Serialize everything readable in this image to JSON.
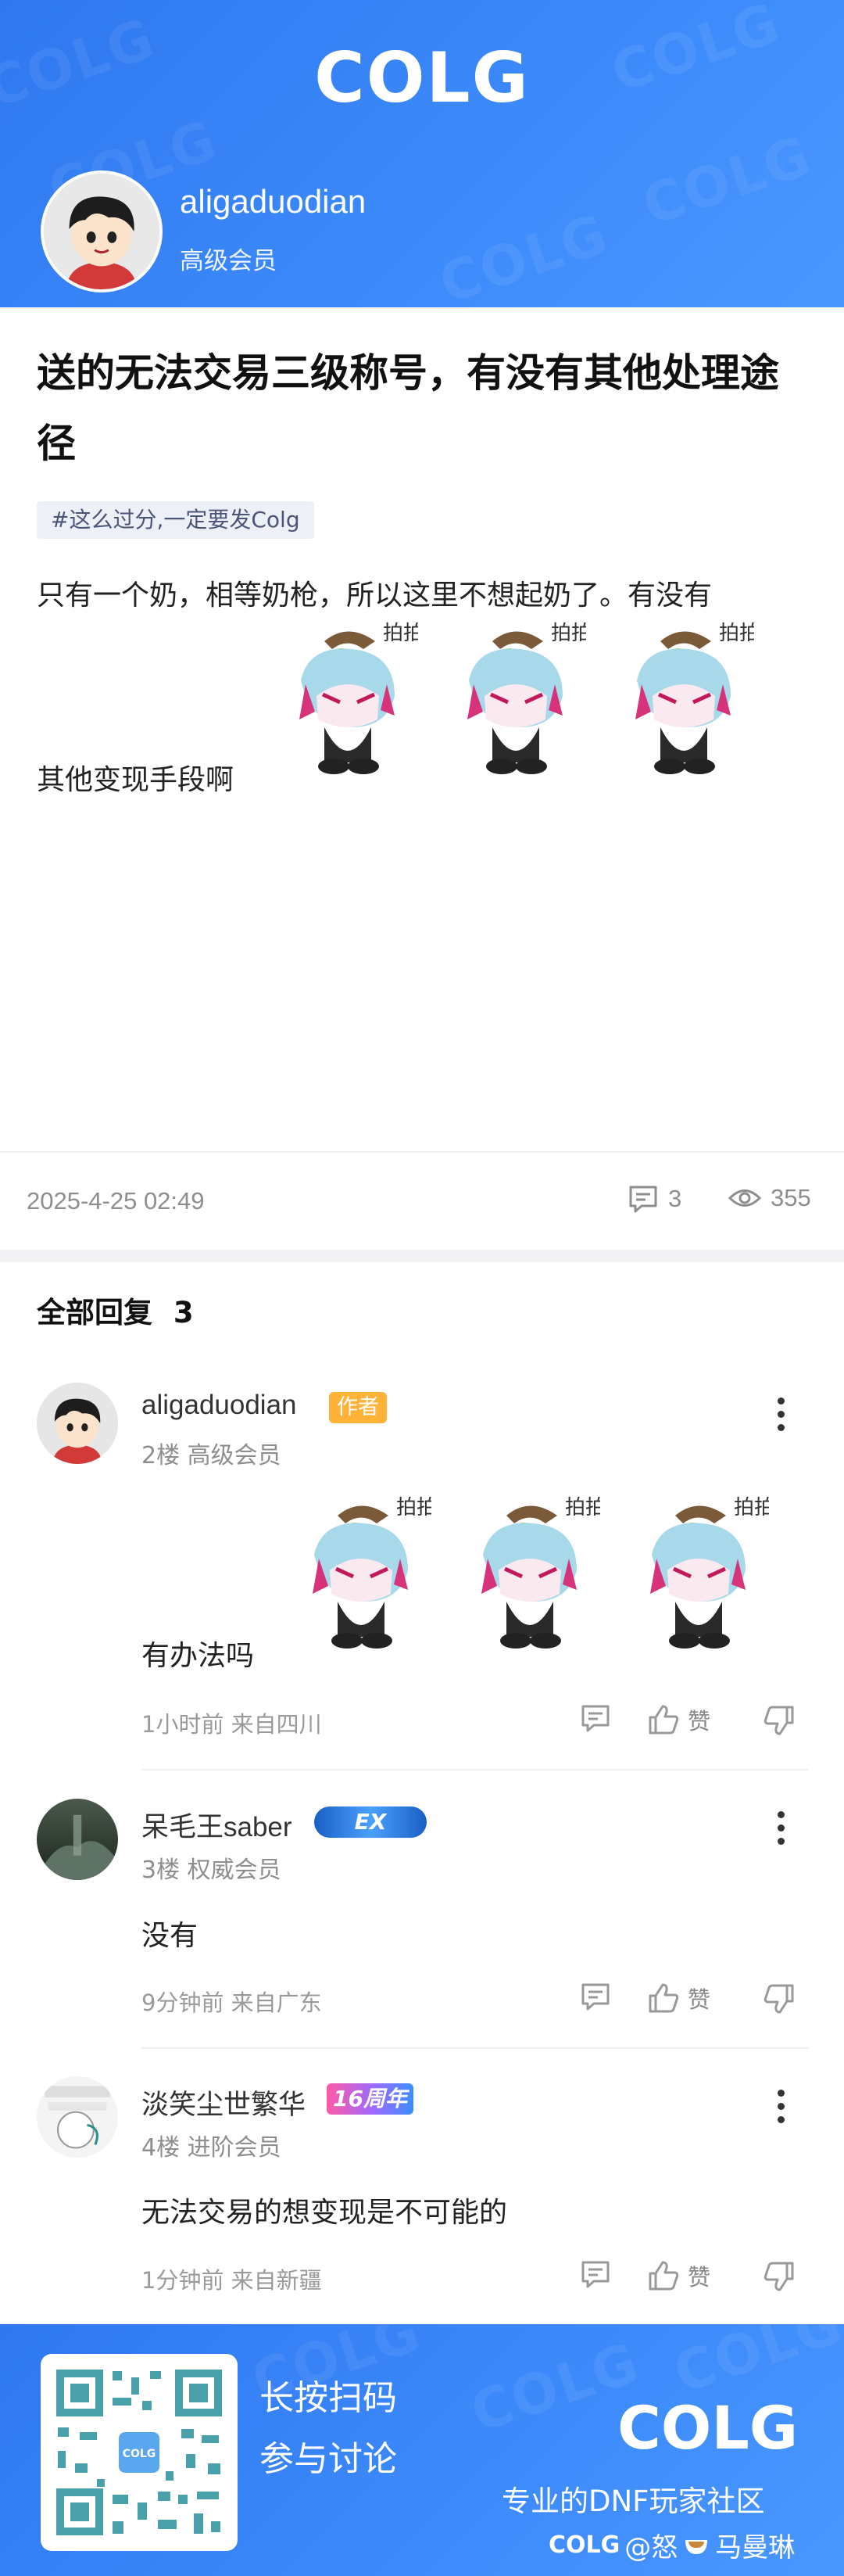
{
  "header": {
    "logo": "COLG",
    "user": {
      "name": "aligaduodian",
      "level": "高级会员"
    }
  },
  "post": {
    "title": "送的无法交易三级称号，有没有其他处理途径",
    "tag": "#这么过分,一定要发Colg",
    "body_line1": "只有一个奶，相等奶枪，所以这里不想起奶了。有没有",
    "body_line2": "其他变现手段啊",
    "sticker_text": "拍拍",
    "date": "2025-4-25 02:49",
    "comment_count": "3",
    "view_count": "355"
  },
  "replies": {
    "header": "全部回复",
    "count": "3",
    "like_label": "赞",
    "items": [
      {
        "name": "aligaduodian",
        "badge": "作者",
        "sub": "2楼 高级会员",
        "text": "有办法吗",
        "time": "1小时前 来自四川"
      },
      {
        "name": "呆毛王saber",
        "badge": "EX",
        "sub": "3楼 权威会员",
        "text": "没有",
        "time": "9分钟前 来自广东"
      },
      {
        "name": "淡笑尘世繁华",
        "badge": "16周年",
        "sub": "4楼 进阶会员",
        "text": "无法交易的想变现是不可能的",
        "time": "1分钟前 来自新疆"
      }
    ]
  },
  "footer": {
    "cta_line1": "长按扫码",
    "cta_line2": "参与讨论",
    "logo": "COLG",
    "slogan": "专业的DNF玩家社区",
    "credit_logo": "COLG",
    "credit_text": "@怒",
    "credit_name": "马曼琳"
  },
  "colors": {
    "brand_blue": "#3d8bfb",
    "author_badge": "#ffb238"
  }
}
